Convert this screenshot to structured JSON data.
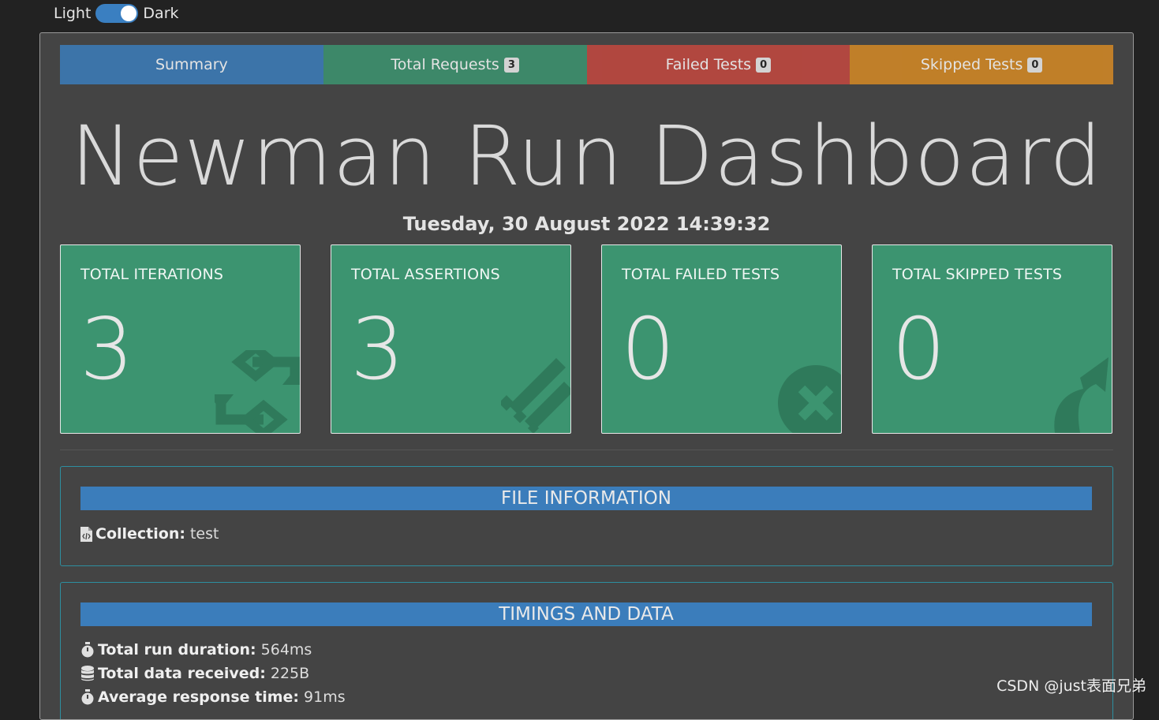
{
  "theme_toggle": {
    "light_label": "Light",
    "dark_label": "Dark",
    "state": "dark"
  },
  "tabs": [
    {
      "label": "Summary",
      "badge": null
    },
    {
      "label": "Total Requests",
      "badge": "3"
    },
    {
      "label": "Failed Tests",
      "badge": "0"
    },
    {
      "label": "Skipped Tests",
      "badge": "0"
    }
  ],
  "header": {
    "title": "Newman Run Dashboard",
    "date": "Tuesday, 30 August 2022 14:39:32"
  },
  "cards": [
    {
      "label": "TOTAL ITERATIONS",
      "value": "3",
      "icon": "retweet-icon"
    },
    {
      "label": "TOTAL ASSERTIONS",
      "value": "3",
      "icon": "pencil-ruler-icon"
    },
    {
      "label": "TOTAL FAILED TESTS",
      "value": "0",
      "icon": "times-circle-icon"
    },
    {
      "label": "TOTAL SKIPPED TESTS",
      "value": "0",
      "icon": "share-arrow-icon"
    }
  ],
  "file_information": {
    "heading": "FILE INFORMATION",
    "collection_label": "Collection:",
    "collection_value": "test"
  },
  "timings": {
    "heading": "TIMINGS AND DATA",
    "items": [
      {
        "label": "Total run duration:",
        "value": "564ms",
        "icon": "stopwatch-icon"
      },
      {
        "label": "Total data received:",
        "value": "225B",
        "icon": "database-icon"
      },
      {
        "label": "Average response time:",
        "value": "91ms",
        "icon": "stopwatch-icon"
      }
    ]
  },
  "watermark": "CSDN @just表面兄弟",
  "colors": {
    "summary": "#3b7dbb",
    "success": "#3c9470",
    "danger": "#c4483f",
    "warning": "#d68a24",
    "panel_bg": "#444444",
    "page_bg": "#222222"
  }
}
